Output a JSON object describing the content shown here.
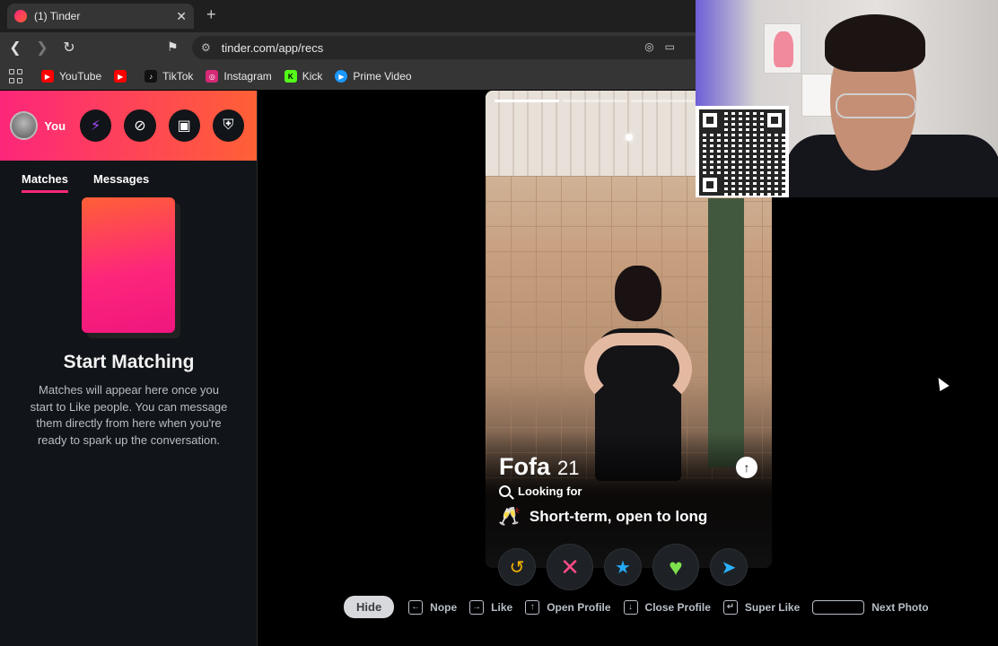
{
  "browser": {
    "tab_title": "(1) Tinder",
    "url": "tinder.com/app/recs",
    "bookmarks": [
      {
        "label": "YouTube",
        "color": "#ff0000"
      },
      {
        "label": "",
        "color": "#ff0000"
      },
      {
        "label": "TikTok",
        "color": "#111111"
      },
      {
        "label": "Instagram",
        "color": "#d62976"
      },
      {
        "label": "Kick",
        "color": "#53fc18"
      },
      {
        "label": "Prime Video",
        "color": "#1a98ff"
      }
    ]
  },
  "sidebar": {
    "you_label": "You",
    "tabs": [
      {
        "label": "Matches",
        "active": true
      },
      {
        "label": "Messages",
        "active": false
      }
    ],
    "start_title": "Start Matching",
    "start_description": "Matches will appear here once you start to Like people. You can message them directly from here when you're ready to spark up the conversation."
  },
  "profile": {
    "name": "Fofa",
    "age": "21",
    "looking_for_label": "Looking for",
    "intent_emoji": "🥂",
    "intent": "Short-term, open to long",
    "photo_count": 4,
    "current_photo": 1
  },
  "actions": [
    {
      "name": "rewind",
      "glyph": "↺"
    },
    {
      "name": "nope",
      "glyph": "✕"
    },
    {
      "name": "super-like",
      "glyph": "★"
    },
    {
      "name": "like",
      "glyph": "♥"
    },
    {
      "name": "boost",
      "glyph": "➤"
    }
  ],
  "shortcuts": {
    "hide_label": "Hide",
    "items": [
      {
        "key": "←",
        "label": "Nope"
      },
      {
        "key": "→",
        "label": "Like"
      },
      {
        "key": "↑",
        "label": "Open Profile"
      },
      {
        "key": "↓",
        "label": "Close Profile"
      },
      {
        "key": "↵",
        "label": "Super Like"
      },
      {
        "key": "",
        "label": "Next Photo"
      }
    ]
  },
  "colors": {
    "brand_start": "#fd267a",
    "brand_end": "#ff6036"
  }
}
